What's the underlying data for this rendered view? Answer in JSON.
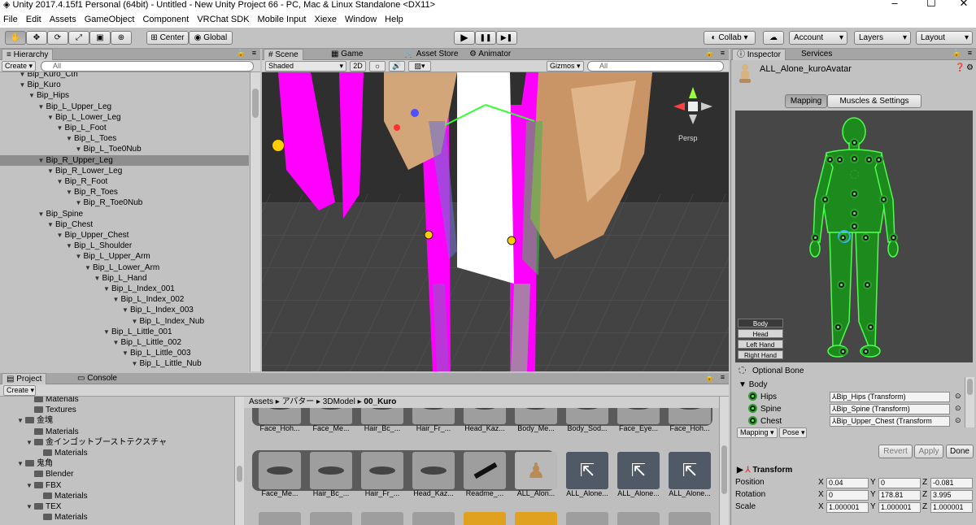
{
  "window": {
    "title": "Unity 2017.4.15f1 Personal (64bit) - Untitled - New Unity Project 66 - PC, Mac & Linux Standalone <DX11>",
    "minimize": "–",
    "maximize": "☐",
    "close": "✕"
  },
  "menu": [
    "File",
    "Edit",
    "Assets",
    "GameObject",
    "Component",
    "VRChat SDK",
    "Mobile Input",
    "Xiexe",
    "Window",
    "Help"
  ],
  "toolbar": {
    "tools": [
      "hand-icon",
      "move-icon",
      "rotate-icon",
      "scale-icon",
      "rect-icon",
      "transform-icon"
    ],
    "pivot": "Center",
    "space": "Global",
    "play": "▶",
    "pause": "❚❚",
    "step": "▶❚",
    "collab": "Collab ▾",
    "cloud": "☁",
    "account": "Account",
    "layers": "Layers",
    "layout": "Layout"
  },
  "hierarchy": {
    "tab": "Hierarchy",
    "create": "Create ▾",
    "search_placeholder": "All",
    "items": [
      {
        "name": "Bip_Kuro_Ctrl",
        "depth": 1
      },
      {
        "name": "Bip_Kuro",
        "depth": 1
      },
      {
        "name": "Bip_Hips",
        "depth": 2
      },
      {
        "name": "Bip_L_Upper_Leg",
        "depth": 3
      },
      {
        "name": "Bip_L_Lower_Leg",
        "depth": 4
      },
      {
        "name": "Bip_L_Foot",
        "depth": 5
      },
      {
        "name": "Bip_L_Toes",
        "depth": 6
      },
      {
        "name": "Bip_L_Toe0Nub",
        "depth": 7
      },
      {
        "name": "Bip_R_Upper_Leg",
        "depth": 3
      },
      {
        "name": "Bip_R_Lower_Leg",
        "depth": 4
      },
      {
        "name": "Bip_R_Foot",
        "depth": 5
      },
      {
        "name": "Bip_R_Toes",
        "depth": 6
      },
      {
        "name": "Bip_R_Toe0Nub",
        "depth": 7
      },
      {
        "name": "Bip_Spine",
        "depth": 3
      },
      {
        "name": "Bip_Chest",
        "depth": 4
      },
      {
        "name": "Bip_Upper_Chest",
        "depth": 5
      },
      {
        "name": "Bip_L_Shoulder",
        "depth": 6
      },
      {
        "name": "Bip_L_Upper_Arm",
        "depth": 7
      },
      {
        "name": "Bip_L_Lower_Arm",
        "depth": 8
      },
      {
        "name": "Bip_L_Hand",
        "depth": 9
      },
      {
        "name": "Bip_L_Index_001",
        "depth": 10
      },
      {
        "name": "Bip_L_Index_002",
        "depth": 11
      },
      {
        "name": "Bip_L_Index_003",
        "depth": 12
      },
      {
        "name": "Bip_L_Index_Nub",
        "depth": 13
      },
      {
        "name": "Bip_L_Little_001",
        "depth": 10
      },
      {
        "name": "Bip_L_Little_002",
        "depth": 11
      },
      {
        "name": "Bip_L_Little_003",
        "depth": 12
      },
      {
        "name": "Bip_L_Little_Nub",
        "depth": 13
      }
    ],
    "selected": 8
  },
  "scene": {
    "tabs": [
      "Scene",
      "Game",
      "Asset Store",
      "Animator"
    ],
    "shading": "Shaded",
    "mode2d": "2D",
    "gizmos": "Gizmos ▾",
    "search_placeholder": "All",
    "persp": "Persp"
  },
  "project": {
    "tabs": [
      "Project",
      "Console"
    ],
    "create": "Create ▾",
    "tree": [
      {
        "name": "Materials",
        "depth": 2
      },
      {
        "name": "Textures",
        "depth": 2
      },
      {
        "name": "金塊",
        "depth": 1
      },
      {
        "name": "Materials",
        "depth": 2
      },
      {
        "name": "金インゴットブーストテクスチャ",
        "depth": 2
      },
      {
        "name": "Materials",
        "depth": 3
      },
      {
        "name": "鬼角",
        "depth": 1
      },
      {
        "name": "Blender",
        "depth": 2
      },
      {
        "name": "FBX",
        "depth": 2
      },
      {
        "name": "Materials",
        "depth": 3
      },
      {
        "name": "TEX",
        "depth": 2
      },
      {
        "name": "Materials",
        "depth": 3
      }
    ],
    "breadcrumb": [
      "Assets",
      "アバター",
      "3DModel",
      "00_Kuro"
    ],
    "row1": [
      "Face_Hoh...",
      "Face_Me...",
      "Hair_Bc_...",
      "Hair_Fr_...",
      "Head_Kaz...",
      "Body_Me...",
      "Body_Sod...",
      "Face_Eye...",
      "Face_Hoh..."
    ],
    "row2": [
      "Face_Me...",
      "Hair_Bc_...",
      "Hair_Fr_...",
      "Head_Kaz...",
      "Readme_...",
      "ALL_Alon...",
      "ALL_Alone...",
      "ALL_Alone...",
      "ALL_Alone..."
    ]
  },
  "inspector": {
    "tabs": [
      "Inspector",
      "Services"
    ],
    "object_name": "ALL_Alone_kuroAvatar",
    "mapping_tabs": [
      "Mapping",
      "Muscles & Settings"
    ],
    "body_buttons": [
      "Body",
      "Head",
      "Left Hand",
      "Right Hand"
    ],
    "optional_bone": "Optional Bone",
    "section_body": "Body",
    "bones": [
      {
        "label": "Hips",
        "value": "Bip_Hips (Transform)"
      },
      {
        "label": "Spine",
        "value": "Bip_Spine (Transform)"
      },
      {
        "label": "Chest",
        "value": "Bip_Upper_Chest (Transform"
      }
    ],
    "bottom_mapping": "Mapping ▾",
    "bottom_pose": "Pose ▾",
    "revert": "Revert",
    "apply": "Apply",
    "done": "Done",
    "transform": {
      "title": "Transform",
      "position": {
        "label": "Position",
        "x": "0.04",
        "y": "0",
        "z": "-0.081"
      },
      "rotation": {
        "label": "Rotation",
        "x": "0",
        "y": "178.81",
        "z": "3.995"
      },
      "scale": {
        "label": "Scale",
        "x": "1.000001",
        "y": "1.000001",
        "z": "1.000001"
      }
    },
    "axis_x": "X",
    "axis_y": "Y",
    "axis_z": "Z"
  },
  "colors": {
    "accent_green": "#2ba22b",
    "magenta": "#ff00ff",
    "selection": "#8e8e8e"
  }
}
